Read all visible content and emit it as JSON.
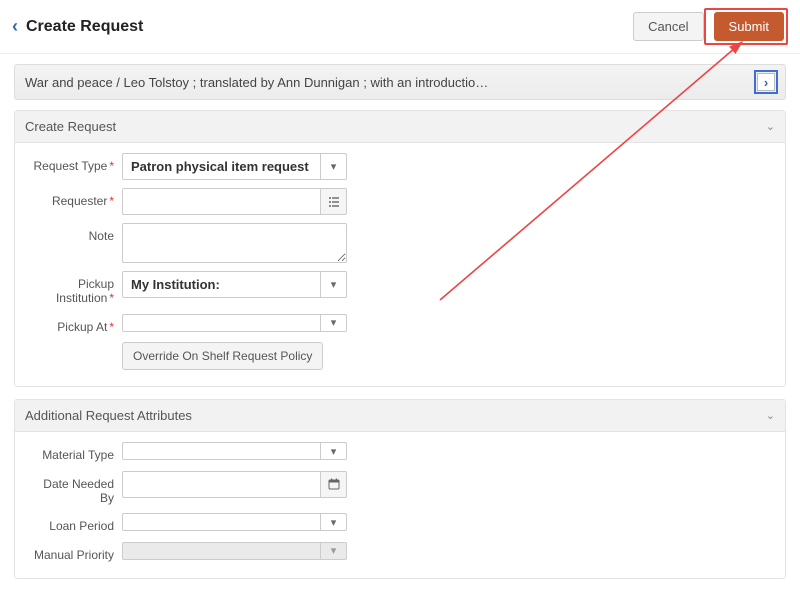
{
  "header": {
    "page_title": "Create Request",
    "cancel_label": "Cancel",
    "submit_label": "Submit"
  },
  "item": {
    "title": "War and peace / Leo Tolstoy ; translated by Ann Dunnigan ; with an introductio…"
  },
  "panels": {
    "create": {
      "title": "Create Request"
    },
    "attrs": {
      "title": "Additional Request Attributes"
    }
  },
  "labels": {
    "request_type": "Request Type",
    "requester": "Requester",
    "note": "Note",
    "pickup_institution": "Pickup Institution",
    "pickup_at": "Pickup At",
    "override": "Override On Shelf Request Policy",
    "material_type": "Material Type",
    "date_needed_by": "Date Needed By",
    "loan_period": "Loan Period",
    "manual_priority": "Manual Priority"
  },
  "values": {
    "request_type": "Patron physical item request",
    "requester": "",
    "note": "",
    "pickup_institution": "My Institution:",
    "pickup_at": "",
    "material_type": "",
    "date_needed_by": "",
    "loan_period": "",
    "manual_priority": ""
  }
}
